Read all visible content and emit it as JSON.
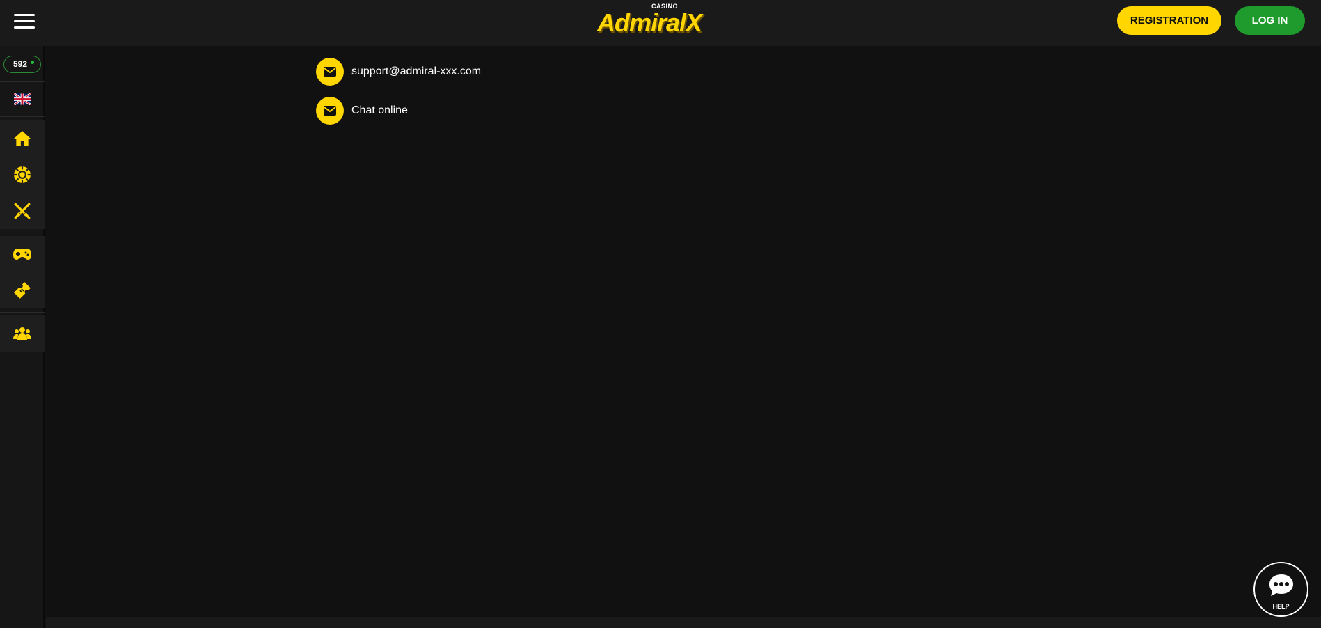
{
  "header": {
    "menu_icon": "hamburger-icon",
    "logo": {
      "small": "CASINO",
      "main": "AdmiralX"
    },
    "registration_label": "REGISTRATION",
    "login_label": "LOG IN",
    "colors": {
      "accent": "#ffd600",
      "login": "#1f9a2c",
      "background": "#1a1a1a"
    }
  },
  "sidebar": {
    "online_count": "592",
    "language_icon": "uk-flag-icon",
    "items": [
      {
        "icon": "home-icon"
      },
      {
        "icon": "casino-chip-icon"
      },
      {
        "icon": "crossed-swords-icon"
      },
      {
        "icon": "gamepad-icon"
      },
      {
        "icon": "ticket-icon"
      },
      {
        "icon": "users-group-icon"
      }
    ]
  },
  "contacts": [
    {
      "icon": "mail-icon",
      "label": "support@admiral-xxx.com"
    },
    {
      "icon": "mail-icon",
      "label": "Chat online"
    }
  ],
  "help": {
    "icon": "chat-bubble-icon",
    "label": "HELP"
  }
}
